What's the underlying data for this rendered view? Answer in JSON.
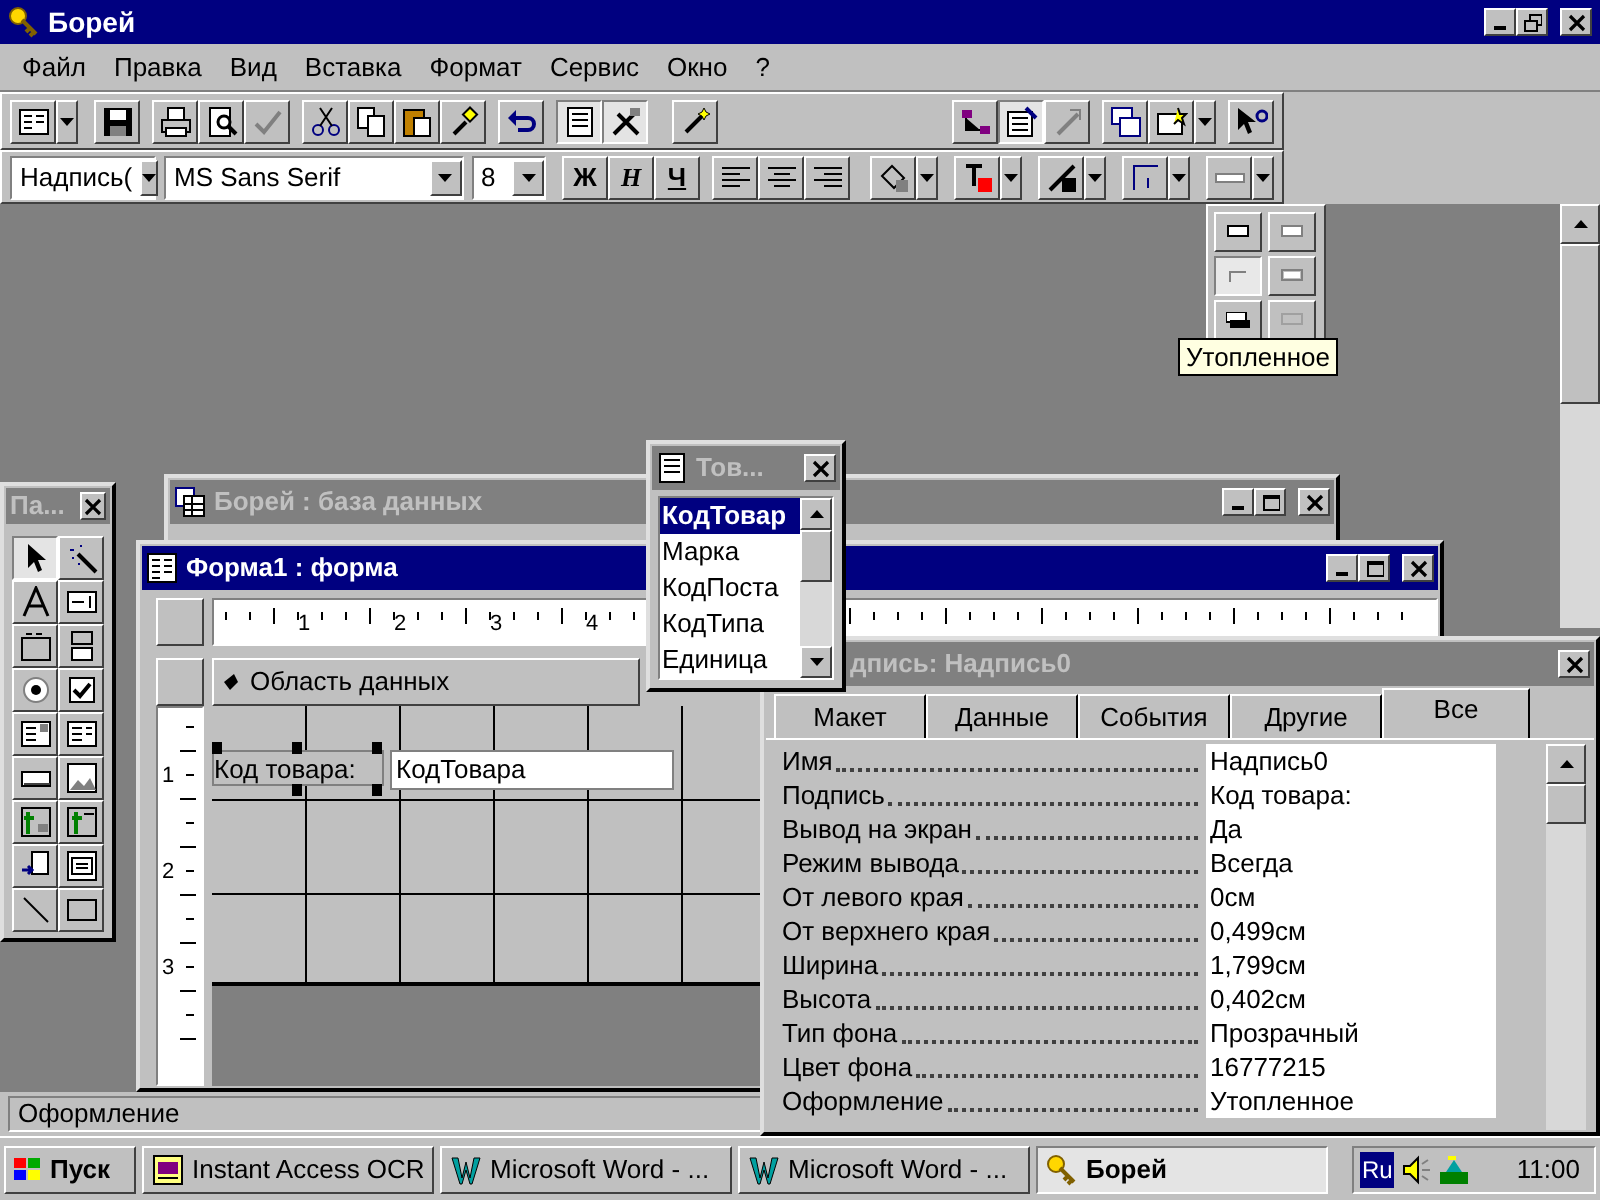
{
  "app_window": {
    "title": "Борей"
  },
  "menu": [
    "Файл",
    "Правка",
    "Вид",
    "Вставка",
    "Формат",
    "Сервис",
    "Окно",
    "?"
  ],
  "standard_toolbar": {
    "field_list_on": true,
    "toolbox_on": true,
    "properties_on": true
  },
  "format_toolbar": {
    "object_combo": "Надпись(",
    "font_combo": "MS Sans Serif",
    "size_combo": "8",
    "bold": "Ж",
    "italic": "Н",
    "underline": "Ч"
  },
  "effect_popup": {
    "effects": [
      {
        "selected": false
      },
      {
        "selected": false
      },
      {
        "selected": true
      },
      {
        "selected": false
      },
      {
        "selected": false
      },
      {
        "selected": false
      }
    ],
    "tooltip": "Утопленное"
  },
  "toolbox": {
    "title": "Па...",
    "pointer_selected": true
  },
  "db_window": {
    "title": "Борей : база данных",
    "active": false
  },
  "form_window": {
    "title": "Форма1 : форма",
    "active": true,
    "ruler_numbers": [
      "1",
      "2",
      "3",
      "4"
    ],
    "section": "Область данных",
    "vertical_numbers": [
      "1",
      "2",
      "3"
    ],
    "label": "Код товара:",
    "textbox": "КодТовара"
  },
  "field_list": {
    "title": "Тов...",
    "items": [
      {
        "text": "КодТовар",
        "selected": true
      },
      {
        "text": "Марка",
        "selected": false
      },
      {
        "text": "КодПоста",
        "selected": false
      },
      {
        "text": "КодТипа",
        "selected": false
      },
      {
        "text": "Единица",
        "selected": false
      }
    ]
  },
  "properties": {
    "title": "дпись: Надпись0",
    "tabs": [
      {
        "label": "Макет",
        "selected": false
      },
      {
        "label": "Данные",
        "selected": false
      },
      {
        "label": "События",
        "selected": false
      },
      {
        "label": "Другие",
        "selected": false
      },
      {
        "label": "Все",
        "selected": true
      }
    ],
    "rows": [
      {
        "name": "Имя",
        "value": "Надпись0"
      },
      {
        "name": "Подпись",
        "value": "Код товара:"
      },
      {
        "name": "Вывод на экран",
        "value": "Да"
      },
      {
        "name": "Режим вывода",
        "value": "Всегда"
      },
      {
        "name": "От левого края",
        "value": "0см"
      },
      {
        "name": "От верхнего края",
        "value": "0,499см"
      },
      {
        "name": "Ширина",
        "value": "1,799см"
      },
      {
        "name": "Высота",
        "value": "0,402см"
      },
      {
        "name": "Тип фона",
        "value": "Прозрачный"
      },
      {
        "name": "Цвет фона",
        "value": "16777215"
      },
      {
        "name": "Оформление",
        "value": "Утопленное"
      }
    ]
  },
  "status_bar": {
    "text": "Оформление"
  },
  "taskbar": {
    "start": "Пуск",
    "tasks": [
      {
        "title": "Instant Access OCR",
        "kind": "ocr",
        "selected": false
      },
      {
        "title": "Microsoft Word - ...",
        "kind": "word",
        "selected": false
      },
      {
        "title": "Microsoft Word - ...",
        "kind": "word",
        "selected": false
      },
      {
        "title": "Борей",
        "kind": "access",
        "selected": true
      }
    ],
    "language": "Ru",
    "clock": "11:00"
  }
}
